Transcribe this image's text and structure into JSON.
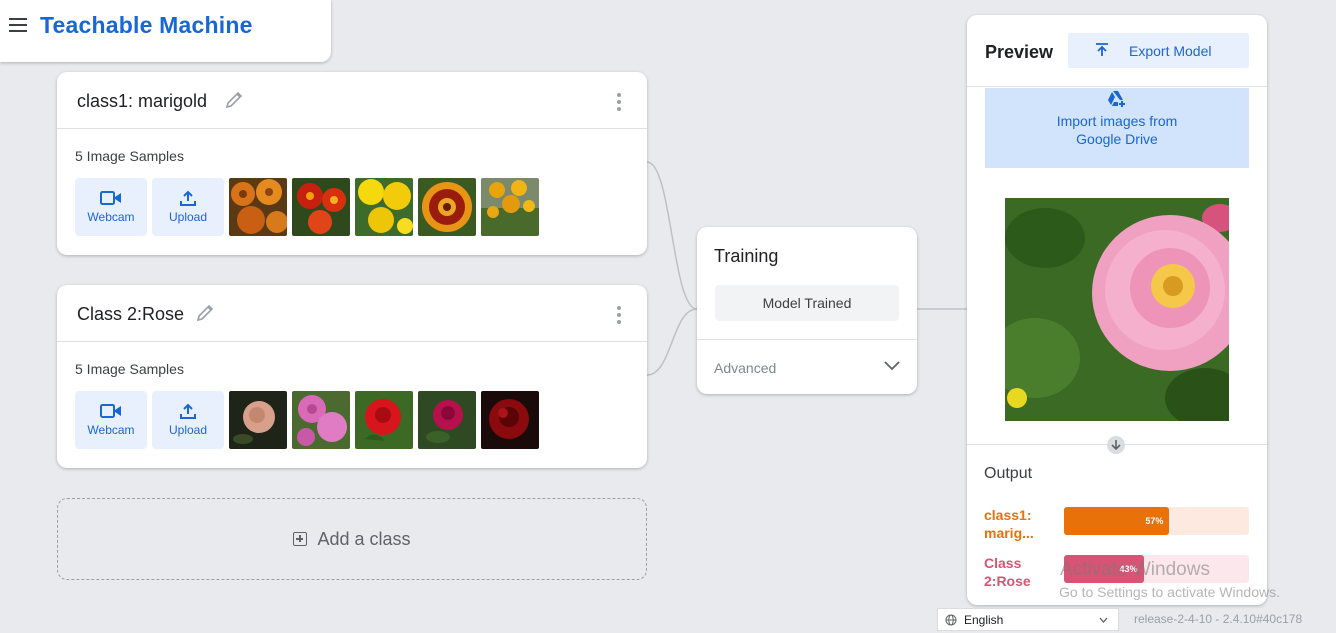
{
  "header": {
    "title": "Teachable Machine"
  },
  "classes": [
    {
      "name": "class1: marigold",
      "samples_label": "5 Image Samples",
      "webcam_label": "Webcam",
      "upload_label": "Upload",
      "thumbnails": [
        "marigold-orange",
        "marigold-red",
        "marigold-yellow",
        "marigold-bicolor",
        "marigold-plant"
      ]
    },
    {
      "name": "Class 2:Rose",
      "samples_label": "5 Image Samples",
      "webcam_label": "Webcam",
      "upload_label": "Upload",
      "thumbnails": [
        "rose-peach",
        "rose-pink",
        "rose-red",
        "rose-magenta",
        "rose-dark-red"
      ]
    }
  ],
  "add_class": {
    "label": "Add a class"
  },
  "training": {
    "title": "Training",
    "button_label": "Model Trained",
    "advanced_label": "Advanced"
  },
  "preview": {
    "title": "Preview",
    "export_label": "Export Model",
    "drive_line1": "Import images from",
    "drive_line2": "Google Drive",
    "output_title": "Output",
    "outputs": [
      {
        "label_line1": "class1:",
        "label_line2": "marig...",
        "percent_text": "57%",
        "fraction": 0.57,
        "color": "#e8710a",
        "track_color": "#fde9e0"
      },
      {
        "label_line1": "Class",
        "label_line2": "2:Rose",
        "percent_text": "43%",
        "fraction": 0.43,
        "color": "#d85474",
        "track_color": "#fce8ec"
      }
    ]
  },
  "watermark": {
    "line1": "Activate Windows",
    "line2": "Go to Settings to activate Windows."
  },
  "footer": {
    "language": "English",
    "release": "release-2-4-10 - 2.4.10#40c178"
  },
  "colors": {
    "brand": "#1967d2",
    "accent_bg": "#e8f0fe"
  }
}
